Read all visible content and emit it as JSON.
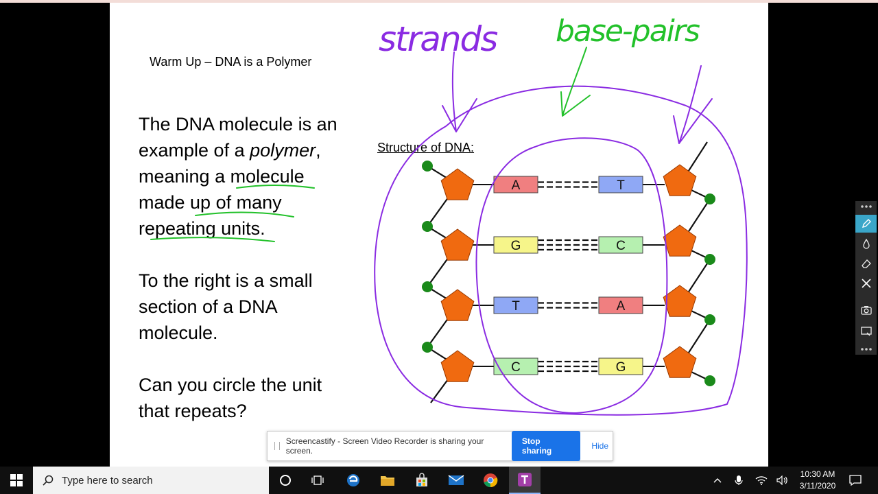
{
  "slide": {
    "title": "Warm Up – DNA is a Polymer",
    "body": {
      "p1": [
        {
          "text": "The DNA molecule is an"
        },
        {
          "text": "example of a ",
          "italic": "polymer",
          "after": ","
        },
        {
          "text": "meaning a molecule"
        },
        {
          "text": "made up of many"
        },
        {
          "text": "repeating units."
        }
      ],
      "p2": [
        {
          "text": "To the right is a small"
        },
        {
          "text": "section of a DNA"
        },
        {
          "text": "molecule."
        }
      ],
      "p3": [
        {
          "text": "Can you circle the unit"
        },
        {
          "text": "that repeats?"
        }
      ]
    },
    "diagram": {
      "title": "Structure of DNA:",
      "pairs": [
        {
          "left": "A",
          "right": "T",
          "left_color": "#f07f80",
          "right_color": "#8fa8f5"
        },
        {
          "left": "G",
          "right": "C",
          "left_color": "#f6f58a",
          "right_color": "#b6f0b0"
        },
        {
          "left": "T",
          "right": "A",
          "left_color": "#8fa8f5",
          "right_color": "#f07f80"
        },
        {
          "left": "C",
          "right": "G",
          "left_color": "#b6f0b0",
          "right_color": "#f6f58a"
        }
      ],
      "sugar_color": "#f06a10",
      "phosphate_color": "#1a8a1a"
    },
    "annotations": {
      "strands": "strands",
      "base_pairs": "base-pairs",
      "ink_purple": "#8a2be2",
      "ink_green": "#22c12a"
    }
  },
  "share_bar": {
    "message": "Screencastify - Screen Video Recorder is sharing your screen.",
    "stop_label": "Stop sharing",
    "hide_label": "Hide"
  },
  "ink_toolbar": {
    "tools": [
      "more-icon",
      "pen-icon",
      "ink-drop-icon",
      "eraser-icon",
      "close-icon",
      "camera-icon",
      "whiteboard-icon",
      "more-icon"
    ]
  },
  "taskbar": {
    "search_placeholder": "Type here to search",
    "time": "10:30 AM",
    "date": "3/11/2020"
  }
}
